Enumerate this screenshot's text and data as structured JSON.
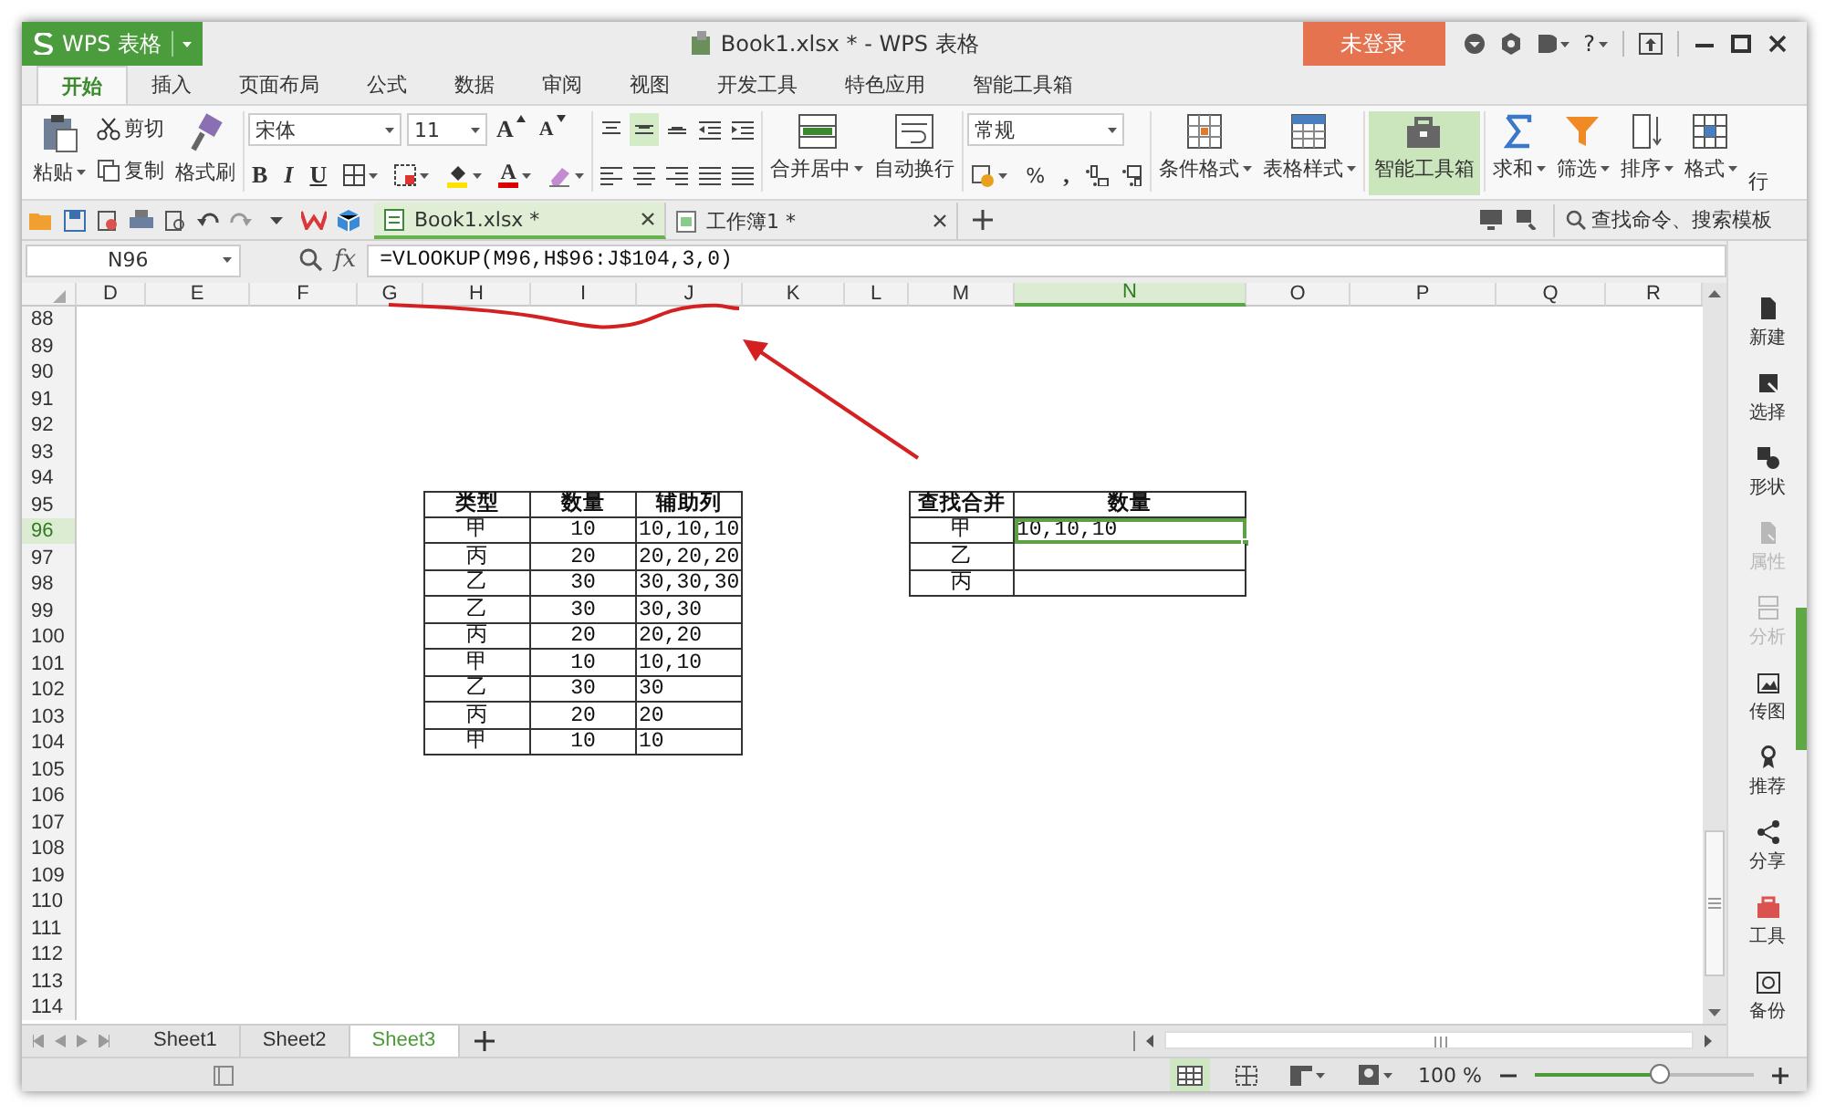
{
  "app_button": {
    "label": "WPS 表格"
  },
  "window": {
    "title": "Book1.xlsx * - WPS 表格"
  },
  "login_button": {
    "label": "未登录"
  },
  "help": "?",
  "menu_tabs": [
    {
      "label": "开始",
      "selected": true
    },
    {
      "label": "插入",
      "selected": false
    },
    {
      "label": "页面布局",
      "selected": false
    },
    {
      "label": "公式",
      "selected": false
    },
    {
      "label": "数据",
      "selected": false
    },
    {
      "label": "审阅",
      "selected": false
    },
    {
      "label": "视图",
      "selected": false
    },
    {
      "label": "开发工具",
      "selected": false
    },
    {
      "label": "特色应用",
      "selected": false
    },
    {
      "label": "智能工具箱",
      "selected": false
    }
  ],
  "ribbon": {
    "paste": "粘贴",
    "cut": "剪切",
    "copy": "复制",
    "format_painter": "格式刷",
    "font_name": "宋体",
    "font_size": "11",
    "grow_font": "A",
    "shrink_font": "A",
    "bold": "B",
    "italic": "I",
    "underline": "U",
    "font_color": "A",
    "vertical_align": [
      {
        "selected": false
      },
      {
        "selected": true
      },
      {
        "selected": false
      }
    ],
    "merge_center": "合并居中",
    "wrap_text": "自动换行",
    "number_format": "常规",
    "percent": "%",
    "thousands": ",",
    "conditional_format": "条件格式",
    "table_style": "表格样式",
    "smart_toolbox": {
      "label": "智能工具箱",
      "selected": true
    },
    "sum": "求和",
    "filter": "筛选",
    "sort": "排序",
    "format": "格式",
    "row": "行"
  },
  "doc_tabs": [
    {
      "label": "Book1.xlsx *",
      "selected": true
    },
    {
      "label": "工作簿1 *",
      "selected": false
    }
  ],
  "search": {
    "placeholder": "查找命令、搜索模板"
  },
  "formula_bar": {
    "name_box": "N96",
    "fx_label": "fx",
    "formula": "=VLOOKUP(M96,H$96:J$104,3,0)"
  },
  "sheet": {
    "columns": [
      {
        "label": "D",
        "selected": false
      },
      {
        "label": "E",
        "selected": false
      },
      {
        "label": "F",
        "selected": false
      },
      {
        "label": "G",
        "selected": false
      },
      {
        "label": "H",
        "selected": false
      },
      {
        "label": "I",
        "selected": false
      },
      {
        "label": "J",
        "selected": false
      },
      {
        "label": "K",
        "selected": false
      },
      {
        "label": "L",
        "selected": false
      },
      {
        "label": "M",
        "selected": false
      },
      {
        "label": "N",
        "selected": true
      },
      {
        "label": "O",
        "selected": false
      },
      {
        "label": "P",
        "selected": false
      },
      {
        "label": "Q",
        "selected": false
      },
      {
        "label": "R",
        "selected": false
      }
    ],
    "rows": [
      {
        "label": "88",
        "selected": false
      },
      {
        "label": "89",
        "selected": false
      },
      {
        "label": "90",
        "selected": false
      },
      {
        "label": "91",
        "selected": false
      },
      {
        "label": "92",
        "selected": false
      },
      {
        "label": "93",
        "selected": false
      },
      {
        "label": "94",
        "selected": false
      },
      {
        "label": "95",
        "selected": false
      },
      {
        "label": "96",
        "selected": true
      },
      {
        "label": "97",
        "selected": false
      },
      {
        "label": "98",
        "selected": false
      },
      {
        "label": "99",
        "selected": false
      },
      {
        "label": "100",
        "selected": false
      },
      {
        "label": "101",
        "selected": false
      },
      {
        "label": "102",
        "selected": false
      },
      {
        "label": "103",
        "selected": false
      },
      {
        "label": "104",
        "selected": false
      },
      {
        "label": "105",
        "selected": false
      },
      {
        "label": "106",
        "selected": false
      },
      {
        "label": "107",
        "selected": false
      },
      {
        "label": "108",
        "selected": false
      },
      {
        "label": "109",
        "selected": false
      },
      {
        "label": "110",
        "selected": false
      },
      {
        "label": "111",
        "selected": false
      },
      {
        "label": "112",
        "selected": false
      },
      {
        "label": "113",
        "selected": false
      },
      {
        "label": "114",
        "selected": false
      }
    ],
    "tables": [
      {
        "header": [
          "类型",
          "数量",
          "辅助列"
        ],
        "rows": [
          [
            {
              "text": "甲",
              "selected": false
            },
            {
              "text": "10",
              "selected": false
            },
            {
              "text": "10,10,10",
              "selected": false
            }
          ],
          [
            {
              "text": "丙",
              "selected": false
            },
            {
              "text": "20",
              "selected": false
            },
            {
              "text": "20,20,20",
              "selected": false
            }
          ],
          [
            {
              "text": "乙",
              "selected": false
            },
            {
              "text": "30",
              "selected": false
            },
            {
              "text": "30,30,30",
              "selected": false
            }
          ],
          [
            {
              "text": "乙",
              "selected": false
            },
            {
              "text": "30",
              "selected": false
            },
            {
              "text": "30,30",
              "selected": false
            }
          ],
          [
            {
              "text": "丙",
              "selected": false
            },
            {
              "text": "20",
              "selected": false
            },
            {
              "text": "20,20",
              "selected": false
            }
          ],
          [
            {
              "text": "甲",
              "selected": false
            },
            {
              "text": "10",
              "selected": false
            },
            {
              "text": "10,10",
              "selected": false
            }
          ],
          [
            {
              "text": "乙",
              "selected": false
            },
            {
              "text": "30",
              "selected": false
            },
            {
              "text": "30",
              "selected": false
            }
          ],
          [
            {
              "text": "丙",
              "selected": false
            },
            {
              "text": "20",
              "selected": false
            },
            {
              "text": "20",
              "selected": false
            }
          ],
          [
            {
              "text": "甲",
              "selected": false
            },
            {
              "text": "10",
              "selected": false
            },
            {
              "text": "10",
              "selected": false
            }
          ]
        ]
      },
      {
        "header": [
          "查找合并",
          "数量"
        ],
        "rows": [
          [
            {
              "text": "甲",
              "selected": false
            },
            {
              "text": "10,10,10",
              "selected": true
            }
          ],
          [
            {
              "text": "乙",
              "selected": false
            }
          ],
          [
            {
              "text": "丙",
              "selected": false
            }
          ]
        ]
      }
    ]
  },
  "sidebar": [
    {
      "label": "新建",
      "disabled": false
    },
    {
      "label": "选择",
      "disabled": false
    },
    {
      "label": "形状",
      "disabled": false
    },
    {
      "label": "属性",
      "disabled": true
    },
    {
      "label": "分析",
      "disabled": true
    },
    {
      "label": "传图",
      "disabled": false
    },
    {
      "label": "推荐",
      "disabled": false
    },
    {
      "label": "分享",
      "disabled": false
    },
    {
      "label": "工具",
      "disabled": false
    },
    {
      "label": "备份",
      "disabled": false
    }
  ],
  "sheet_tabs": [
    {
      "label": "Sheet1",
      "selected": false
    },
    {
      "label": "Sheet2",
      "selected": false
    },
    {
      "label": "Sheet3",
      "selected": true
    }
  ],
  "status_bar": {
    "zoom": "100 %",
    "zoom_slider": {
      "level": 0.57
    }
  }
}
